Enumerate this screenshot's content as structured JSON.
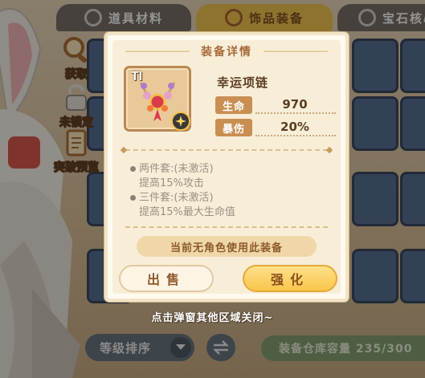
{
  "tabs": [
    {
      "label": "道具材料",
      "active": false
    },
    {
      "label": "饰品装备",
      "active": true
    },
    {
      "label": "宝石核心",
      "active": false
    }
  ],
  "side_buttons": {
    "acquire": "获取",
    "lock": "未锁定",
    "breakthrough": "突破预览"
  },
  "tile_tier": "TI",
  "tile_plus": "+1",
  "modal": {
    "title": "装备详情",
    "item": {
      "tier": "TI",
      "name": "幸运项链",
      "icon": "necklace-icon"
    },
    "stats": [
      {
        "label": "生命",
        "value": "970"
      },
      {
        "label": "暴伤",
        "value": "20%"
      }
    ],
    "sets": [
      {
        "title": "两件套:(未激活)",
        "desc": "提高15%攻击"
      },
      {
        "title": "三件套:(未激活)",
        "desc": "提高15%最大生命值"
      }
    ],
    "notice": "当前无角色使用此装备",
    "sell_label": "出售",
    "upgrade_label": "强化"
  },
  "close_hint": "点击弹窗其他区域关闭~",
  "bottom": {
    "sort_label": "等级排序",
    "capacity": "装备仓库容量 235/300"
  },
  "colors": {
    "accent_gold": "#f8c64a",
    "stat_label_bg": "#c98f52",
    "text_brown": "#5b3d22",
    "capacity_green": "#7f9e6f"
  }
}
